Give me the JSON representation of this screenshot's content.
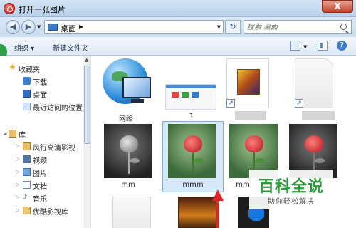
{
  "window": {
    "title": "打开一张图片",
    "close_glyph": "X"
  },
  "address": {
    "location": "桌面",
    "search_placeholder": "搜索 桌面"
  },
  "toolbar": {
    "organize_label": "组织 ▾",
    "new_folder_label": "新建文件夹",
    "help_glyph": "?"
  },
  "sidebar": {
    "favorites": {
      "label": "收藏夹",
      "items": [
        "下载",
        "桌面",
        "最近访问的位置"
      ]
    },
    "library": {
      "label": "库",
      "items": [
        "风行高清影视",
        "视频",
        "图片",
        "文档",
        "音乐",
        "优酷影视库"
      ]
    }
  },
  "files": {
    "network_label": "网络",
    "file1_label": "1",
    "photo_labels": [
      "mm",
      "mmm",
      "mm",
      ""
    ]
  },
  "watermark": {
    "title": "百科全说",
    "subtitle": "助你轻松解决"
  }
}
